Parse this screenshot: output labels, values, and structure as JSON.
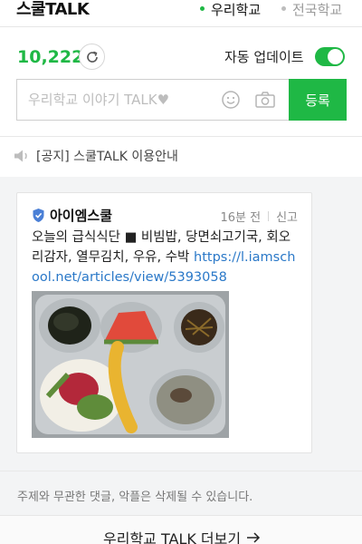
{
  "header": {
    "brand": "스쿨TALK",
    "scope_tabs": [
      {
        "label": "우리학교",
        "active": true
      },
      {
        "label": "전국학교",
        "active": false
      }
    ]
  },
  "stats": {
    "count": "10,222",
    "auto_update_label": "자동 업데이트",
    "auto_update_on": true
  },
  "composer": {
    "placeholder": "우리학교 이야기 TALK♥",
    "submit_label": "등록"
  },
  "notice": {
    "text": "[공지] 스쿨TALK 이용안내"
  },
  "post": {
    "author": "아이엠스쿨",
    "time": "16분 전",
    "report_label": "신고",
    "text": "오늘의 급식식단 ■ 비빔밥, 당면쇠고기국, 회오리감자, 열무김치, 우유, 수박 ",
    "link": "https://l.iamschool.net/articles/view/5393058"
  },
  "policy_text": "주제와 무관한 댓글, 악플은 삭제될 수 있습니다.",
  "more_label": "우리학교 TALK 더보기",
  "colors": {
    "accent": "#1fb845",
    "link": "#2a78c8",
    "verified_badge": "#4a7fd6"
  }
}
